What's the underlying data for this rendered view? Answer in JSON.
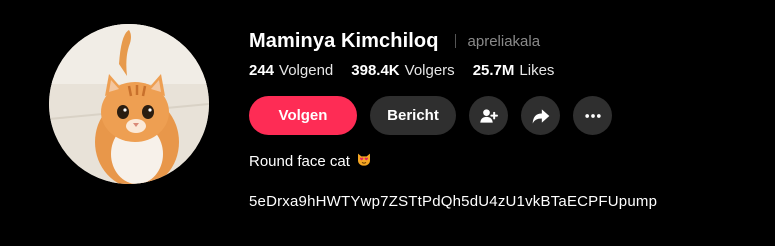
{
  "profile": {
    "display_name": "Maminya Kimchiloq",
    "handle": "apreliakala",
    "avatar_icon": "orange-cat-photo",
    "stats": [
      {
        "value": "244",
        "label": "Volgend"
      },
      {
        "value": "398.4K",
        "label": "Volgers"
      },
      {
        "value": "25.7M",
        "label": "Likes"
      }
    ],
    "bio": "Round face cat",
    "bio_emoji": "smiling-cat-heart-eyes-emoji",
    "link_text": "5eDrxa9hHWTYwp7ZSTtPdQh5dU4zU1vkBTaECPFUpump"
  },
  "actions": {
    "follow_label": "Volgen",
    "message_label": "Bericht",
    "add_friend_icon": "add-user-icon",
    "share_icon": "share-arrow-icon",
    "more_icon": "more-dots-icon"
  },
  "colors": {
    "background": "#000000",
    "follow_button": "#fe2c55",
    "secondary_button": "#2f2f2f",
    "muted_text": "#8a8a8a"
  }
}
